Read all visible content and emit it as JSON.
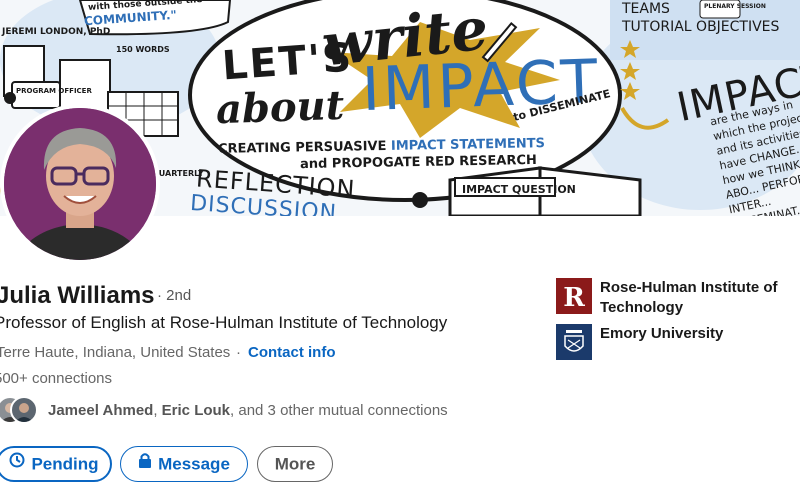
{
  "banner": {
    "lets": "LET'S",
    "write": "write",
    "about": "about",
    "impact": "IMPACT",
    "persuasive_pre": "CREATING PERSUASIVE",
    "persuasive_blue": "IMPACT STATEMENTS",
    "propagate": "and PROPOGATE RED RESEARCH",
    "disseminate": "to DISSEMINATE",
    "reflection": "REFLECTION",
    "discussion": "DISCUSSION",
    "impact_question": "IMPACT QUESTION",
    "teams": "TEAMS",
    "tutorial_objectives": "TUTORIAL OBJECTIVES",
    "plenary": "PLENARY SESSION",
    "impacts": "IMPACTS",
    "impacts_def": "are the ways in which the project and its activities have CHANGE... how we THINK ABO... PERFORM, INTER... DISSEMINAT...",
    "community": "COMMUNITY.\"",
    "with_those": "with those outside the",
    "landon": "JEREMI LONDON, PhD",
    "program_officer": "PROGRAM OFFICER",
    "words_150": "150 WORDS",
    "quarterly": "QUARTERLY"
  },
  "profile": {
    "name": "Julia Williams",
    "degree": "· 2nd",
    "headline": "Professor of English at Rose-Hulman Institute of Technology",
    "location": "Terre Haute, Indiana, United States",
    "separator": "·",
    "contact_info": "Contact info",
    "connections": "500+ connections",
    "mutual_names_1": "Jameel Ahmed",
    "mutual_sep": ", ",
    "mutual_names_2": "Eric Louk",
    "mutual_rest": ", and 3 other mutual connections"
  },
  "actions": {
    "pending": "Pending",
    "message": "Message",
    "more": "More"
  },
  "orgs": [
    {
      "name": "Rose-Hulman Institute of Technology",
      "logo": "rose-hulman-logo"
    },
    {
      "name": "Emory University",
      "logo": "emory-logo"
    }
  ],
  "colors": {
    "linkedin_blue": "#0a66c2",
    "banner_gold": "#d4a62a",
    "banner_blue": "#2f6fb7",
    "rose_hulman_red": "#8b1a1a",
    "emory_navy": "#1b3a6b",
    "avatar_bg": "#7a2f6e"
  }
}
